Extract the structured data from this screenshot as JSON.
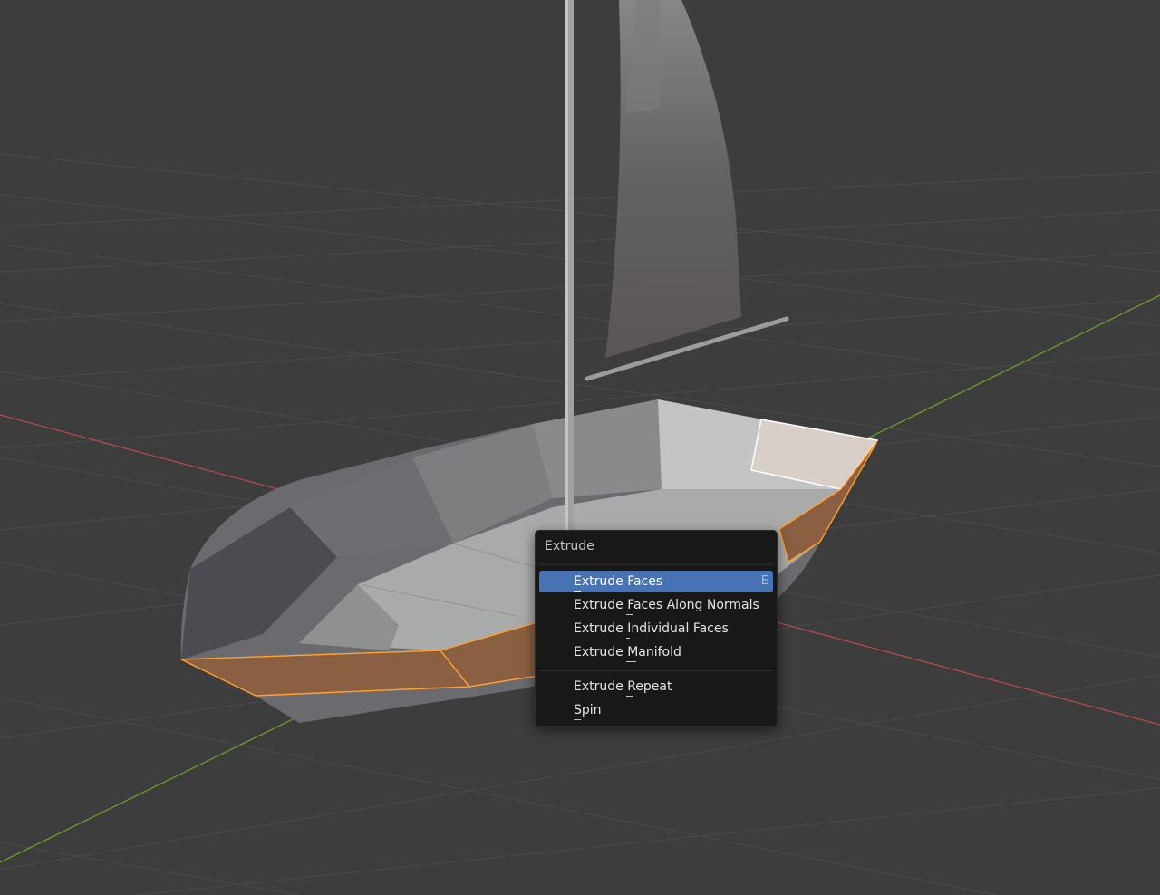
{
  "menu": {
    "title": "Extrude",
    "items": [
      {
        "label": "Extrude Faces",
        "shortcut": "E",
        "active": true
      },
      {
        "label": "Extrude Faces Along Normals",
        "shortcut": "",
        "active": false
      },
      {
        "label": "Extrude Individual Faces",
        "shortcut": "",
        "active": false
      },
      {
        "label": "Extrude Manifold",
        "shortcut": "",
        "active": false
      }
    ],
    "items2": [
      {
        "label": "Extrude Repeat",
        "shortcut": "",
        "active": false
      },
      {
        "label": "Spin",
        "shortcut": "",
        "active": false
      }
    ]
  },
  "colors": {
    "background": "#3d3d3d",
    "grid": "#4a4a4a",
    "x_axis": "#b34a4a",
    "y_axis": "#6f9a2c",
    "selection": "#ffa133",
    "menu_highlight": "#4772b3"
  }
}
